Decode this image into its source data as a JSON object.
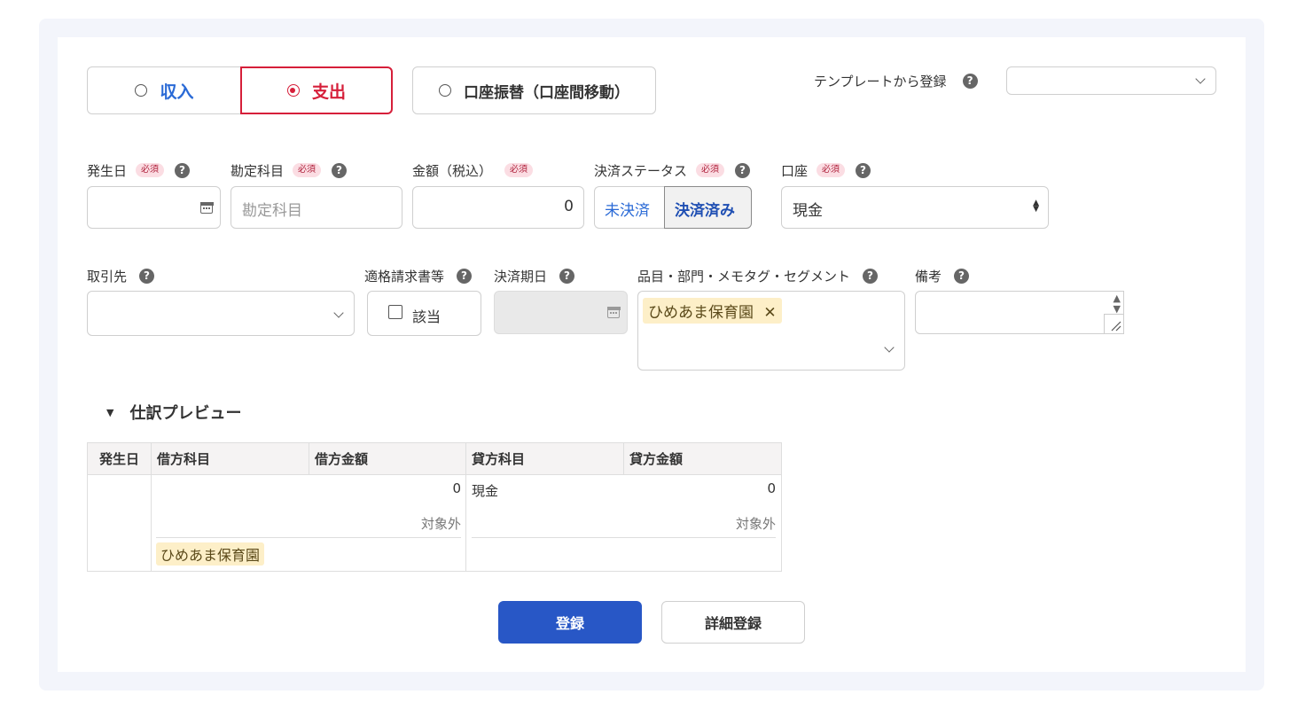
{
  "type_toggle": {
    "income_label": "収入",
    "expense_label": "支出",
    "transfer_label": "口座振替（口座間移動）",
    "selected": "expense"
  },
  "template": {
    "label": "テンプレートから登録",
    "value": ""
  },
  "fields": {
    "date": {
      "label": "発生日",
      "required": "必須",
      "value": ""
    },
    "account_item": {
      "label": "勘定科目",
      "required": "必須",
      "placeholder": "勘定科目"
    },
    "amount": {
      "label": "金額（税込）",
      "required": "必須",
      "value": "0"
    },
    "settlement_status": {
      "label": "決済ステータス",
      "required": "必須",
      "options": [
        "未決済",
        "決済済み"
      ],
      "selected": "決済済み"
    },
    "wallet": {
      "label": "口座",
      "required": "必須",
      "value": "現金"
    },
    "partner": {
      "label": "取引先",
      "value": ""
    },
    "invoice": {
      "label": "適格請求書等",
      "checkbox_label": "該当"
    },
    "due_date": {
      "label": "決済期日",
      "value": ""
    },
    "tags": {
      "label": "品目・部門・メモタグ・セグメント",
      "items": [
        "ひめあま保育園"
      ]
    },
    "remarks": {
      "label": "備考",
      "value": ""
    }
  },
  "help_glyph": "?",
  "preview": {
    "title": "仕訳プレビュー",
    "headers": [
      "発生日",
      "借方科目",
      "借方金額",
      "貸方科目",
      "貸方金額"
    ],
    "debit_amount": "0",
    "debit_tax": "対象外",
    "credit_item": "現金",
    "credit_amount": "0",
    "credit_tax": "対象外",
    "debit_tag": "ひめあま保育園"
  },
  "buttons": {
    "register": "登録",
    "detail_register": "詳細登録"
  },
  "colors": {
    "accent_blue": "#2857c6",
    "expense_red": "#d61f3a",
    "tag_bg": "#fdefc8"
  }
}
